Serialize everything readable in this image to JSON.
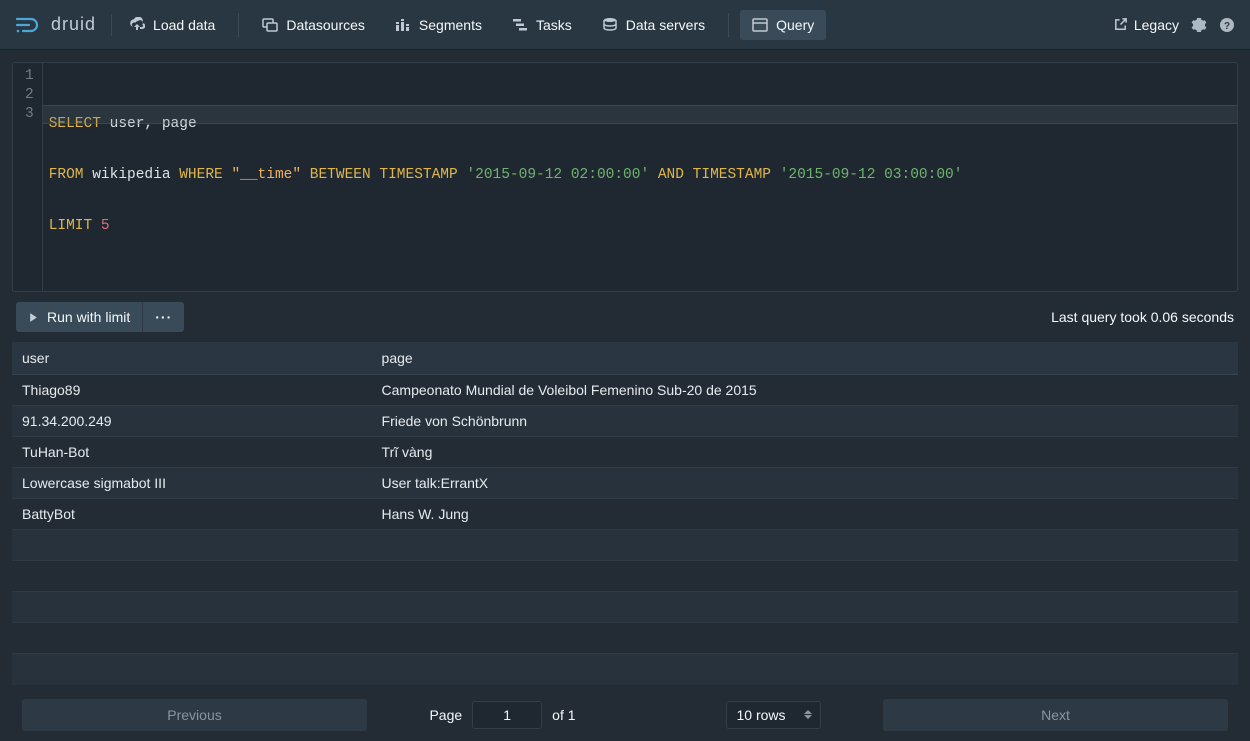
{
  "app": {
    "name": "druid"
  },
  "nav": {
    "load_data": "Load data",
    "datasources": "Datasources",
    "segments": "Segments",
    "tasks": "Tasks",
    "data_servers": "Data servers",
    "query": "Query",
    "legacy": "Legacy"
  },
  "editor": {
    "lines": [
      "1",
      "2",
      "3"
    ],
    "select_kw": "SELECT ",
    "cols": "user, page",
    "from_kw": "FROM ",
    "table": "wikipedia ",
    "where_kw": "WHERE ",
    "time_col": "\"__time\" ",
    "between_kw": "BETWEEN TIMESTAMP ",
    "ts1": "'2015-09-12 02:00:00' ",
    "and_kw": "AND ",
    "timestamp_kw": "TIMESTAMP ",
    "ts2": "'2015-09-12 03:00:00'",
    "limit_kw": "LIMIT ",
    "limit_val": "5"
  },
  "toolbar": {
    "run_label": "Run with limit",
    "more_label": "···",
    "status": "Last query took 0.06 seconds"
  },
  "results": {
    "columns": [
      "user",
      "page"
    ],
    "rows": [
      {
        "user": "Thiago89",
        "page": "Campeonato Mundial de Voleibol Femenino Sub-20 de 2015"
      },
      {
        "user": "91.34.200.249",
        "page": "Friede von Schönbrunn"
      },
      {
        "user": "TuHan-Bot",
        "page": "Trĩ vàng"
      },
      {
        "user": "Lowercase sigmabot III",
        "page": "User talk:ErrantX"
      },
      {
        "user": "BattyBot",
        "page": "Hans W. Jung"
      }
    ]
  },
  "pager": {
    "prev": "Previous",
    "next": "Next",
    "page_label": "Page",
    "page_value": "1",
    "of_label": "of 1",
    "rows_label": "10 rows"
  }
}
